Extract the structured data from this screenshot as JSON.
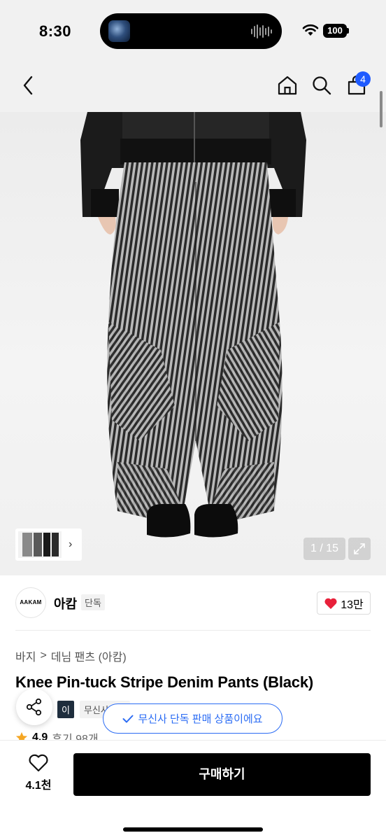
{
  "status_bar": {
    "time": "8:30",
    "battery": "100"
  },
  "nav": {
    "cart_badge": "4"
  },
  "gallery": {
    "counter": "1 / 15"
  },
  "brand": {
    "logo_text": "AAKAM",
    "name": "아캄",
    "tag": "단독",
    "likes": "13만"
  },
  "breadcrumb": {
    "category": "바지",
    "separator": ">",
    "subcategory": "데님 팬츠 (아캄)"
  },
  "product": {
    "title": "Knee Pin-tuck Stripe Denim Pants (Black)"
  },
  "tags": {
    "first": "이",
    "second": "무신사단독"
  },
  "toast": {
    "text": "무신사 단독 판매 상품이에요"
  },
  "rating": {
    "value": "4.9",
    "reviews": "후기 98개"
  },
  "bottom": {
    "wish_count": "4.1천",
    "buy_label": "구매하기"
  },
  "colors": {
    "accent": "#1f5bff",
    "heart": "#e8203a",
    "toast_blue": "#2b6cf4"
  },
  "icons": [
    "back-icon",
    "home-icon",
    "search-icon",
    "cart-icon",
    "share-icon",
    "heart-icon",
    "expand-icon",
    "check-icon",
    "star-icon",
    "wifi-icon",
    "battery-icon"
  ]
}
